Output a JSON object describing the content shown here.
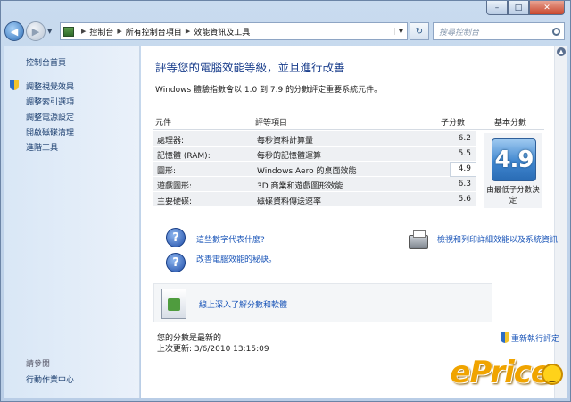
{
  "window": {
    "minimize": "–",
    "maximize": "□",
    "close": "✕"
  },
  "nav": {
    "back": "◀",
    "forward": "▶",
    "breadcrumbs": [
      "控制台",
      "所有控制台項目",
      "效能資訊及工具"
    ],
    "search_placeholder": "搜尋控制台",
    "refresh": "↻"
  },
  "sidebar": {
    "home": "控制台首頁",
    "items": [
      "調整視覺效果",
      "調整索引選項",
      "調整電源設定",
      "開啟磁碟清理",
      "進階工具"
    ],
    "see_also_label": "請參閱",
    "see_also_items": [
      "行動作業中心"
    ]
  },
  "main": {
    "title": "評等您的電腦效能等級，並且進行改善",
    "subtitle": "Windows 體驗指數會以 1.0 到 7.9 的分數評定重要系統元件。",
    "columns": {
      "component": "元件",
      "item": "評等項目",
      "subscore": "子分數",
      "base_score": "基本分數"
    },
    "rows": [
      {
        "component": "處理器:",
        "item": "每秒資料計算量",
        "subscore": "6.2"
      },
      {
        "component": "記憶體 (RAM):",
        "item": "每秒的記憶體運算",
        "subscore": "5.5"
      },
      {
        "component": "圖形:",
        "item": "Windows Aero 的桌面效能",
        "subscore": "4.9"
      },
      {
        "component": "遊戲圖形:",
        "item": "3D 商業和遊戲圖形效能",
        "subscore": "6.3"
      },
      {
        "component": "主要硬碟:",
        "item": "磁碟資料傳送速率",
        "subscore": "5.6"
      }
    ],
    "base_score": "4.9",
    "base_score_note": "由最低子分數決定",
    "links": {
      "what_numbers_mean": "這些數字代表什麼?",
      "improve_tips": "改善電腦效能的秘訣。",
      "print_details": "檢視和列印詳細效能以及系統資訊"
    },
    "banner_link": "線上深入了解分數和軟體",
    "status_line1": "您的分數是最新的",
    "status_line2": "上次更新: 3/6/2010 13:15:09",
    "rerun": "重新執行評定"
  },
  "watermark": "ePrice"
}
